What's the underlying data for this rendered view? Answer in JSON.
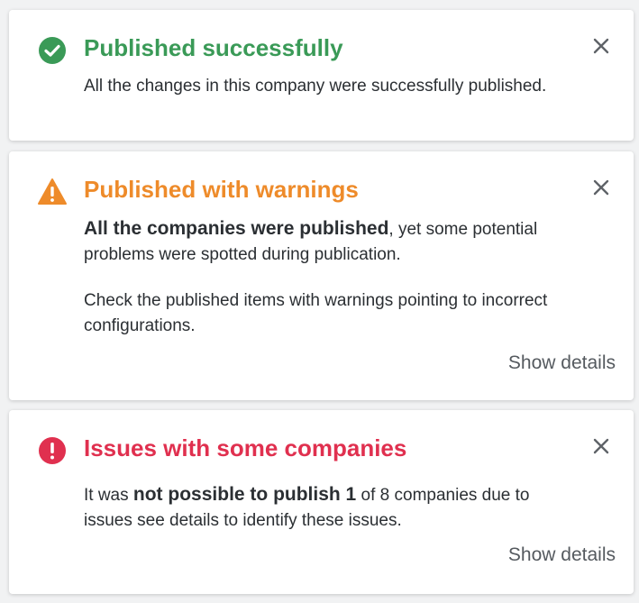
{
  "colors": {
    "success": "#3a9a57",
    "warning": "#ee8b2a",
    "error": "#e0304f",
    "close": "#5f6368"
  },
  "success_toast": {
    "icon": "check-circle-icon",
    "title": "Published successfully",
    "body": "All the changes in this company were successfully published."
  },
  "warning_toast": {
    "icon": "warning-triangle-icon",
    "title": "Published with warnings",
    "body_bold": "All the companies were published",
    "body_rest": ", yet some potential problems were spotted during publication.",
    "body2": "Check the published items with warnings pointing to incorrect configurations.",
    "show_details": "Show details"
  },
  "error_toast": {
    "icon": "error-circle-icon",
    "title": "Issues with some companies",
    "body_pre": "It was ",
    "body_bold": "not possible to publish 1",
    "body_post": " of 8 companies due to issues see details to identify these issues.",
    "show_details": "Show details"
  }
}
